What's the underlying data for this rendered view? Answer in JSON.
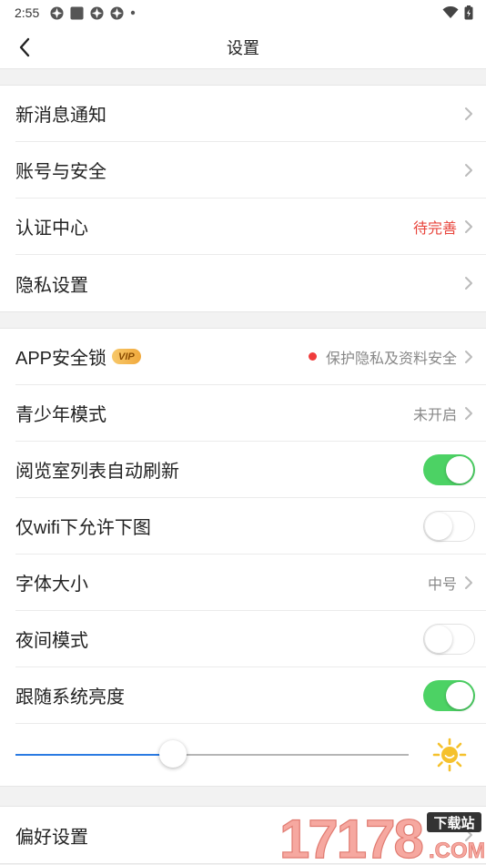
{
  "status_bar": {
    "time": "2:55"
  },
  "header": {
    "title": "设置"
  },
  "section1": [
    {
      "label": "新消息通知",
      "value": ""
    },
    {
      "label": "账号与安全",
      "value": ""
    },
    {
      "label": "认证中心",
      "value": "待完善"
    },
    {
      "label": "隐私设置",
      "value": ""
    }
  ],
  "section2": {
    "app_lock": {
      "label": "APP安全锁",
      "badge": "VIP",
      "value": "保护隐私及资料安全"
    },
    "teen_mode": {
      "label": "青少年模式",
      "value": "未开启"
    },
    "auto_refresh": {
      "label": "阅览室列表自动刷新",
      "on": true
    },
    "wifi_only": {
      "label": "仅wifi下允许下图",
      "on": false
    },
    "font_size": {
      "label": "字体大小",
      "value": "中号"
    },
    "night_mode": {
      "label": "夜间模式",
      "on": false
    },
    "follow_brightness": {
      "label": "跟随系统亮度",
      "on": true
    },
    "brightness": {
      "level": 0.4
    }
  },
  "section3": [
    {
      "label": "偏好设置"
    }
  ],
  "watermark": {
    "text": "17178",
    "sub": "下载站",
    "domain": ".COM"
  },
  "colors": {
    "accent_green": "#4cd264",
    "warn_red": "#e8453c",
    "slider_blue": "#2a7ae2",
    "sun_yellow": "#f5c12c"
  }
}
